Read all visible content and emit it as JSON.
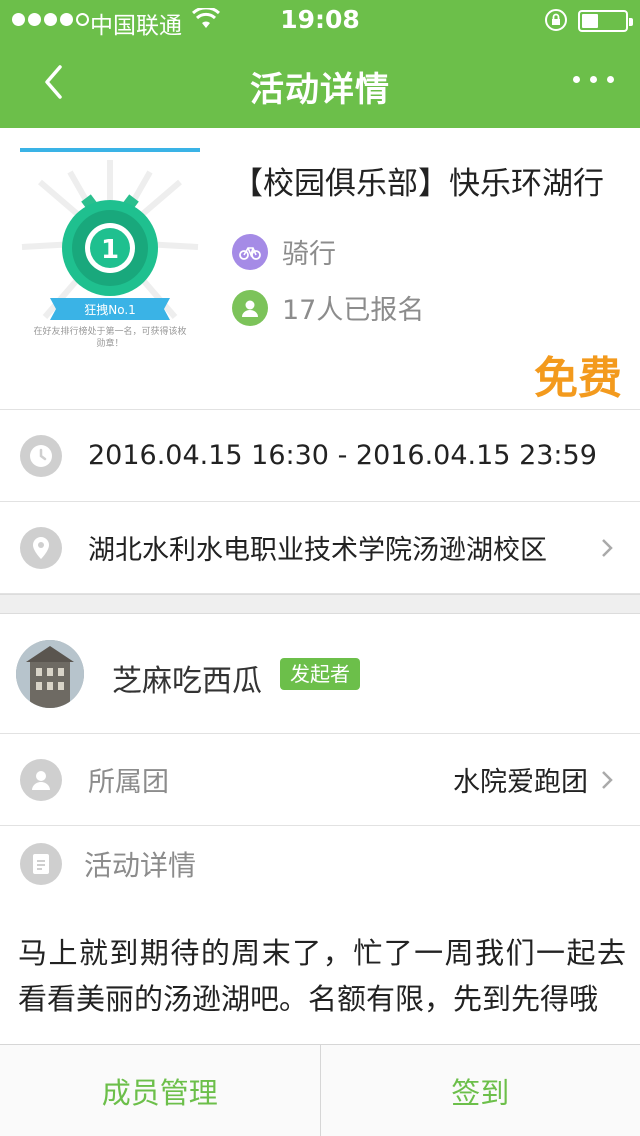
{
  "status_bar": {
    "carrier": "中国联通",
    "time": "19:08"
  },
  "nav": {
    "title": "活动详情"
  },
  "activity": {
    "title": "【校园俱乐部】快乐环湖行",
    "category": "骑行",
    "signup_count": "17人已报名",
    "price": "免费",
    "poster": {
      "badge_text": "狂拽No.1",
      "caption": "在好友排行榜处于第一名，可获得该枚勋章！",
      "medal_number": "1"
    }
  },
  "time_row": {
    "text": "2016.04.15 16:30 - 2016.04.15 23:59"
  },
  "place_row": {
    "text": "湖北水利水电职业技术学院汤逊湖校区"
  },
  "organizer": {
    "name": "芝麻吃西瓜",
    "role_badge": "发起者"
  },
  "group_row": {
    "label": "所属团",
    "value": "水院爱跑团"
  },
  "detail": {
    "label": "活动详情",
    "text": "马上就到期待的周末了，忙了一周我们一起去看看美丽的汤逊湖吧。名额有限，先到先得哦"
  },
  "tabbar": {
    "members": "成员管理",
    "checkin": "签到"
  },
  "colors": {
    "primary": "#6cbf4a",
    "price": "#f39a1d",
    "category_icon": "#a58be6",
    "signup_icon": "#7cc35a",
    "muted_icon": "#cfcfcf"
  }
}
